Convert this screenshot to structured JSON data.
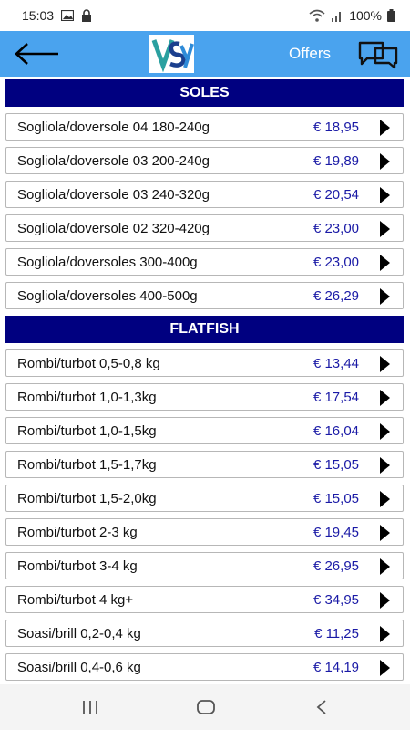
{
  "status_bar": {
    "time": "15:03",
    "battery": "100%",
    "icons": [
      "image-icon",
      "lock-icon",
      "wifi-icon",
      "signal-icon",
      "battery-icon"
    ]
  },
  "app_bar": {
    "back_icon": "back-arrow-icon",
    "logo": "VSY",
    "offers_label": "Offers",
    "chat_icon": "chat-bubbles-icon",
    "color": "#4aa3ee"
  },
  "sections": [
    {
      "title": "SOLES",
      "items": [
        {
          "name": "Sogliola/doversole 04 180-240g",
          "price": "€ 18,95"
        },
        {
          "name": "Sogliola/doversole 03 200-240g",
          "price": "€ 19,89"
        },
        {
          "name": "Sogliola/doversole 03 240-320g",
          "price": "€ 20,54"
        },
        {
          "name": "Sogliola/doversole 02 320-420g",
          "price": "€ 23,00"
        },
        {
          "name": "Sogliola/doversoles 300-400g",
          "price": "€ 23,00"
        },
        {
          "name": "Sogliola/doversoles 400-500g",
          "price": "€ 26,29"
        }
      ]
    },
    {
      "title": "FLATFISH",
      "items": [
        {
          "name": "Rombi/turbot 0,5-0,8 kg",
          "price": "€ 13,44"
        },
        {
          "name": "Rombi/turbot 1,0-1,3kg",
          "price": "€ 17,54"
        },
        {
          "name": "Rombi/turbot 1,0-1,5kg",
          "price": "€ 16,04"
        },
        {
          "name": "Rombi/turbot 1,5-1,7kg",
          "price": "€ 15,05"
        },
        {
          "name": "Rombi/turbot 1,5-2,0kg",
          "price": "€ 15,05"
        },
        {
          "name": "Rombi/turbot 2-3 kg",
          "price": "€ 19,45"
        },
        {
          "name": "Rombi/turbot 3-4 kg",
          "price": "€ 26,95"
        },
        {
          "name": "Rombi/turbot 4 kg+",
          "price": "€ 34,95"
        },
        {
          "name": "Soasi/brill 0,2-0,4 kg",
          "price": "€ 11,25"
        },
        {
          "name": "Soasi/brill 0,4-0,6 kg",
          "price": "€ 14,19"
        }
      ]
    }
  ],
  "nav_bar": {
    "icons": [
      "recent-apps-icon",
      "home-icon",
      "back-icon"
    ]
  }
}
